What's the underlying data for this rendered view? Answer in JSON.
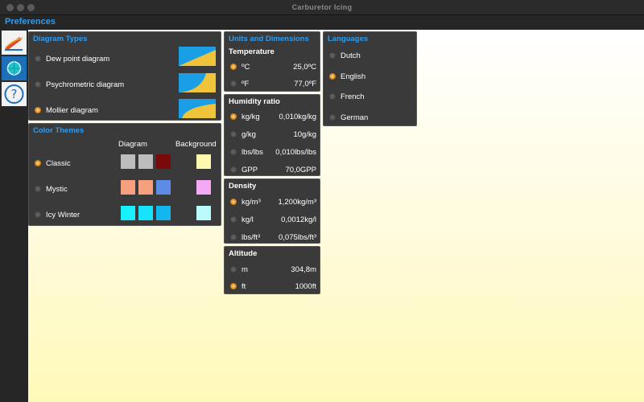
{
  "window": {
    "title": "Carburetor Icing"
  },
  "header": {
    "title": "Preferences"
  },
  "toolbar": [
    {
      "name": "diagram-tool-icon"
    },
    {
      "name": "globe-tool-icon"
    },
    {
      "name": "help-icon"
    }
  ],
  "diagram_types": {
    "title": "Diagram Types",
    "items": [
      {
        "label": "Dew point diagram",
        "selected": false
      },
      {
        "label": "Psychrometric diagram",
        "selected": false
      },
      {
        "label": "Mollier diagram",
        "selected": true
      }
    ]
  },
  "color_themes": {
    "title": "Color Themes",
    "diagram_header": "Diagram",
    "background_header": "Background",
    "items": [
      {
        "label": "Classic",
        "selected": true,
        "diagram": [
          "#bdbdbd",
          "#bdbdbd",
          "#7a0a0a"
        ],
        "background": "#fff9b0"
      },
      {
        "label": "Mystic",
        "selected": false,
        "diagram": [
          "#f7a07e",
          "#f7a07e",
          "#5b8de6"
        ],
        "background": "#f5a8f3"
      },
      {
        "label": "Icy Winter",
        "selected": false,
        "diagram": [
          "#18f0ff",
          "#18e3ff",
          "#12b7f0"
        ],
        "background": "#b9fbff"
      }
    ]
  },
  "units": {
    "title": "Units and Dimensions",
    "temperature": {
      "title": "Temperature",
      "items": [
        {
          "label": "ºC",
          "value": "25,0ºC",
          "selected": true
        },
        {
          "label": "ºF",
          "value": "77,0ºF",
          "selected": false
        }
      ]
    },
    "humidity": {
      "title": "Humidity ratio",
      "items": [
        {
          "label": "kg/kg",
          "value": "0,010kg/kg",
          "selected": true
        },
        {
          "label": "g/kg",
          "value": "10g/kg",
          "selected": false
        },
        {
          "label": "lbs/lbs",
          "value": "0,010lbs/lbs",
          "selected": false
        },
        {
          "label": "GPP",
          "value": "70,0GPP",
          "selected": false
        }
      ]
    },
    "density": {
      "title": "Density",
      "items": [
        {
          "label": "kg/m³",
          "value": "1,200kg/m³",
          "selected": true
        },
        {
          "label": "kg/l",
          "value": "0,0012kg/l",
          "selected": false
        },
        {
          "label": "lbs/ft³",
          "value": "0,075lbs/ft³",
          "selected": false
        }
      ]
    },
    "altitude": {
      "title": "Altitude",
      "items": [
        {
          "label": "m",
          "value": "304,8m",
          "selected": false
        },
        {
          "label": "ft",
          "value": "1000ft",
          "selected": true
        }
      ]
    }
  },
  "languages": {
    "title": "Languages",
    "items": [
      {
        "label": "Dutch",
        "selected": false
      },
      {
        "label": "English",
        "selected": true
      },
      {
        "label": "French",
        "selected": false
      },
      {
        "label": "German",
        "selected": false
      }
    ]
  },
  "colors": {
    "accent": "#2f9cf0",
    "radio_selected": "#f1a535",
    "panel": "#3a3a3a"
  }
}
